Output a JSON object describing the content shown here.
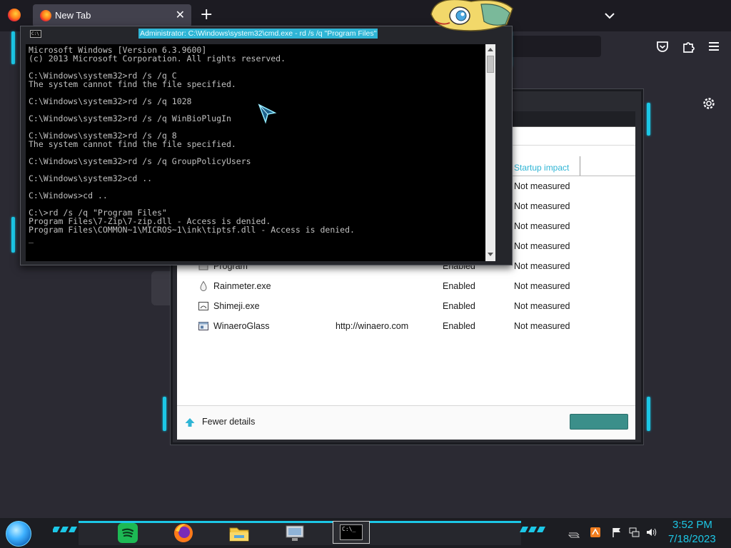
{
  "browser": {
    "tab_title": "New Tab",
    "tab_close": "✕",
    "new_tab": "+"
  },
  "cmd": {
    "title": "Administrator: C:\\Windows\\system32\\cmd.exe - rd  /s /q \"Program Files\"",
    "icon_text": "C:\\",
    "output": "Microsoft Windows [Version 6.3.9600]\n(c) 2013 Microsoft Corporation. All rights reserved.\n\nC:\\Windows\\system32>rd /s /q C\nThe system cannot find the file specified.\n\nC:\\Windows\\system32>rd /s /q 1028\n\nC:\\Windows\\system32>rd /s /q WinBioPlugIn\n\nC:\\Windows\\system32>rd /s /q 8\nThe system cannot find the file specified.\n\nC:\\Windows\\system32>rd /s /q GroupPolicyUsers\n\nC:\\Windows\\system32>cd ..\n\nC:\\Windows>cd ..\n\nC:\\>rd /s /q \"Program Files\"\nProgram Files\\7-Zip\\7-zip.dll - Access is denied.\nProgram Files\\COMMON~1\\MICROS~1\\ink\\tiptsf.dll - Access is denied.\n_"
  },
  "task_manager": {
    "column_startup_impact": "Startup impact",
    "rows": [
      {
        "name": "",
        "publisher": "",
        "status": "",
        "impact": "Not measured",
        "icon": "none"
      },
      {
        "name": "",
        "publisher": "",
        "status": "",
        "impact": "Not measured",
        "icon": "none"
      },
      {
        "name": "",
        "publisher": "",
        "status": "",
        "impact": "Not measured",
        "icon": "none"
      },
      {
        "name": "",
        "publisher": "",
        "status": "",
        "impact": "Not measured",
        "icon": "none"
      },
      {
        "name": "Program",
        "publisher": "",
        "status": "Enabled",
        "impact": "Not measured",
        "icon": "program-icon"
      },
      {
        "name": "Rainmeter.exe",
        "publisher": "",
        "status": "Enabled",
        "impact": "Not measured",
        "icon": "rainmeter-drop-icon"
      },
      {
        "name": "Shimeji.exe",
        "publisher": "",
        "status": "Enabled",
        "impact": "Not measured",
        "icon": "shimeji-app-icon"
      },
      {
        "name": "WinaeroGlass",
        "publisher": "http://winaero.com",
        "status": "Enabled",
        "impact": "Not measured",
        "icon": "winaero-window-icon"
      }
    ],
    "fewer_details": "Fewer details"
  },
  "taskbar": {
    "cmd_icon_text": "C:\\_",
    "clock_time": "3:52 PM",
    "clock_date": "7/18/2023"
  },
  "colors": {
    "accent": "#1cc7e6",
    "cmd_title_highlight": "#2fb5d5"
  }
}
